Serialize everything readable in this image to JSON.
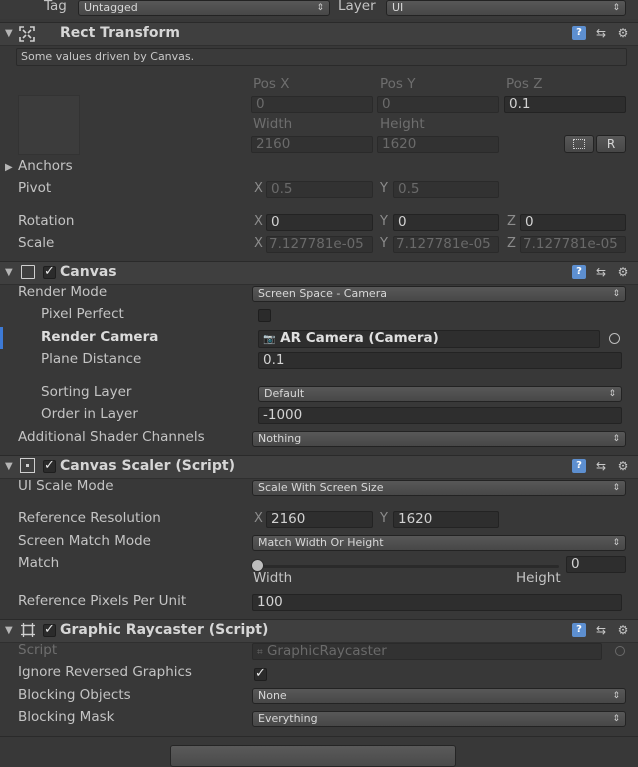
{
  "top": {
    "tag_label": "Tag",
    "tag_value": "Untagged",
    "layer_label": "Layer",
    "layer_value": "UI"
  },
  "rect_transform": {
    "title": "Rect Transform",
    "driven_note": "Some values driven by Canvas.",
    "pos_x_label": "Pos X",
    "pos_y_label": "Pos Y",
    "pos_z_label": "Pos Z",
    "pos_x": "0",
    "pos_y": "0",
    "pos_z": "0.1",
    "width_label": "Width",
    "height_label": "Height",
    "width": "2160",
    "height": "1620",
    "r_button": "R",
    "anchors_label": "Anchors",
    "pivot_label": "Pivot",
    "pivot_x": "0.5",
    "pivot_y": "0.5",
    "rotation_label": "Rotation",
    "rot_x": "0",
    "rot_y": "0",
    "rot_z": "0",
    "scale_label": "Scale",
    "scale_x": "7.127781e-05",
    "scale_y": "7.127781e-05",
    "scale_z": "7.127781e-05",
    "axis_x": "X",
    "axis_y": "Y",
    "axis_z": "Z"
  },
  "canvas": {
    "title": "Canvas",
    "enabled": true,
    "render_mode_label": "Render Mode",
    "render_mode": "Screen Space - Camera",
    "pixel_perfect_label": "Pixel Perfect",
    "pixel_perfect": false,
    "render_camera_label": "Render Camera",
    "render_camera": "AR Camera (Camera)",
    "plane_distance_label": "Plane Distance",
    "plane_distance": "0.1",
    "sorting_layer_label": "Sorting Layer",
    "sorting_layer": "Default",
    "order_in_layer_label": "Order in Layer",
    "order_in_layer": "-1000",
    "shader_channels_label": "Additional Shader Channels",
    "shader_channels": "Nothing"
  },
  "canvas_scaler": {
    "title": "Canvas Scaler (Script)",
    "enabled": true,
    "ui_scale_mode_label": "UI Scale Mode",
    "ui_scale_mode": "Scale With Screen Size",
    "ref_res_label": "Reference Resolution",
    "ref_x": "2160",
    "ref_y": "1620",
    "match_mode_label": "Screen Match Mode",
    "match_mode": "Match Width Or Height",
    "match_label": "Match",
    "match_value": "0",
    "slider_min_label": "Width",
    "slider_max_label": "Height",
    "ref_ppu_label": "Reference Pixels Per Unit",
    "ref_ppu": "100"
  },
  "graphic_raycaster": {
    "title": "Graphic Raycaster (Script)",
    "enabled": true,
    "script_label": "Script",
    "script_value": "GraphicRaycaster",
    "ignore_reversed_label": "Ignore Reversed Graphics",
    "ignore_reversed": true,
    "blocking_objects_label": "Blocking Objects",
    "blocking_objects": "None",
    "blocking_mask_label": "Blocking Mask",
    "blocking_mask": "Everything"
  },
  "colors": {
    "background": "#383838",
    "header": "#3f3f3f",
    "field": "#2e2e2e",
    "accent": "#3d7ad6"
  }
}
